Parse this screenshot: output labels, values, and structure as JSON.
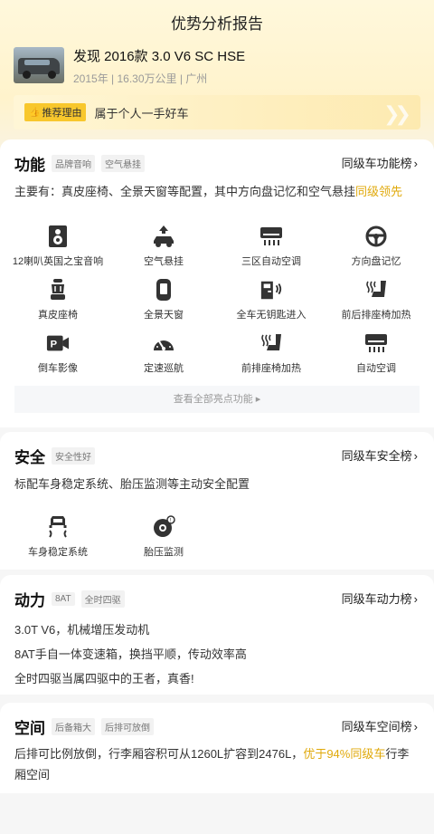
{
  "header": {
    "title": "优势分析报告"
  },
  "car": {
    "name": "发现 2016款 3.0 V6 SC HSE",
    "meta": "2015年 | 16.30万公里 | 广州"
  },
  "reason": {
    "tag": "推荐理由",
    "text": "属于个人一手好车"
  },
  "function": {
    "title": "功能",
    "tags": [
      "品牌音响",
      "空气悬挂"
    ],
    "rank": "同级车功能榜",
    "desc_main": "主要有：真皮座椅、全景天窗等配置，其中方向盘记忆和空气悬挂",
    "desc_highlight": "同级领先",
    "features": [
      {
        "label": "12喇叭英国之宝音响",
        "icon": "speaker-icon"
      },
      {
        "label": "空气悬挂",
        "icon": "air-suspension-icon"
      },
      {
        "label": "三区自动空调",
        "icon": "air-conditioner-icon"
      },
      {
        "label": "方向盘记忆",
        "icon": "steering-wheel-icon"
      },
      {
        "label": "真皮座椅",
        "icon": "leather-seat-icon"
      },
      {
        "label": "全景天窗",
        "icon": "sunroof-icon"
      },
      {
        "label": "全车无钥匙进入",
        "icon": "keyless-door-icon"
      },
      {
        "label": "前后排座椅加热",
        "icon": "seat-heat-icon"
      },
      {
        "label": "倒车影像",
        "icon": "reverse-camera-icon"
      },
      {
        "label": "定速巡航",
        "icon": "cruise-control-icon"
      },
      {
        "label": "前排座椅加热",
        "icon": "front-seat-heat-icon"
      },
      {
        "label": "自动空调",
        "icon": "auto-ac-icon"
      }
    ],
    "more": "查看全部亮点功能"
  },
  "safety": {
    "title": "安全",
    "tags": [
      "安全性好"
    ],
    "rank": "同级车安全榜",
    "desc": "标配车身稳定系统、胎压监测等主动安全配置",
    "features": [
      {
        "label": "车身稳定系统",
        "icon": "stability-control-icon"
      },
      {
        "label": "胎压监测",
        "icon": "tire-pressure-icon"
      }
    ]
  },
  "power": {
    "title": "动力",
    "tags": [
      "8AT",
      "全时四驱"
    ],
    "rank": "同级车动力榜",
    "lines": [
      "3.0T V6，机械增压发动机",
      "8AT手自一体变速箱，换挡平顺，传动效率高",
      "全时四驱当属四驱中的王者，真香!"
    ]
  },
  "space": {
    "title": "空间",
    "tags": [
      "后备箱大",
      "后排可放倒"
    ],
    "rank": "同级车空间榜",
    "desc_main": "后排可比例放倒，行李厢容积可从1260L扩容到2476L，",
    "desc_highlight": "优于94%同级车",
    "desc_tail": "行李厢空间"
  },
  "colors": {
    "accent": "#e0a90b",
    "tag_yellow": "#f8c72c"
  }
}
